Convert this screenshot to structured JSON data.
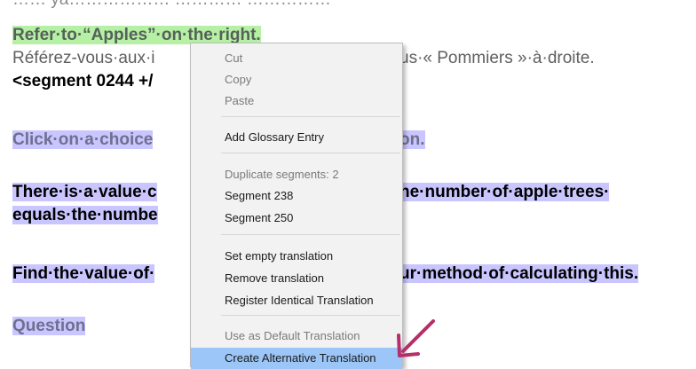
{
  "editor": {
    "line0": "…… ya……………… ………… ……………",
    "line1": "Refer·to·“Apples”·on·the·right.",
    "line2a": "Référez-vous·aux·i",
    "line2b": "us·« Pommiers »·à·droite.",
    "line3": "<segment 0244 +/",
    "line4a": "Click·on·a·choice",
    "line4b": "on.",
    "line5a": "There·is·a·value·c",
    "line5b": "he·number·of·apple·trees·",
    "line6": "equals·the·numbe",
    "line7a": "Find·the·value·of·",
    "line7b": "ur·method·of·calculating·this.",
    "line8": "Question"
  },
  "context_menu": {
    "cut": "Cut",
    "copy": "Copy",
    "paste": "Paste",
    "add_glossary": "Add Glossary Entry",
    "duplicate_segments": "Duplicate segments: 2",
    "segment_238": "Segment 238",
    "segment_250": "Segment 250",
    "set_empty": "Set empty translation",
    "remove_translation": "Remove translation",
    "register_identical": "Register Identical Translation",
    "use_default": "Use as Default Translation",
    "create_alternative": "Create Alternative Translation"
  },
  "annotation": {
    "arrow_color": "#b5306a"
  }
}
